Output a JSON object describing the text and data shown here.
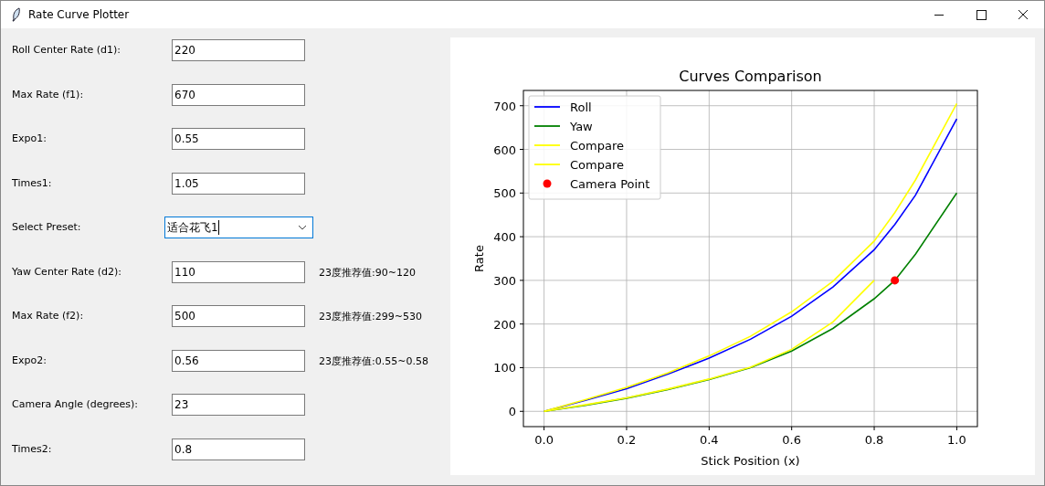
{
  "window": {
    "title": "Rate Curve Plotter"
  },
  "fields": [
    {
      "kind": "entry",
      "label": "Roll Center Rate (d1):",
      "value": "220"
    },
    {
      "kind": "entry",
      "label": "Max Rate (f1):",
      "value": "670"
    },
    {
      "kind": "entry",
      "label": "Expo1:",
      "value": "0.55"
    },
    {
      "kind": "entry",
      "label": "Times1:",
      "value": "1.05"
    },
    {
      "kind": "combobox",
      "label": "Select Preset:",
      "value": "适合花飞1",
      "focused": true
    },
    {
      "kind": "entry",
      "label": "Yaw Center Rate (d2):",
      "value": "110",
      "hint": "23度推荐值:90~120"
    },
    {
      "kind": "entry",
      "label": "Max Rate (f2):",
      "value": "500",
      "hint": "23度推荐值:299~530"
    },
    {
      "kind": "entry",
      "label": "Expo2:",
      "value": "0.56",
      "hint": "23度推荐值:0.55~0.58"
    },
    {
      "kind": "entry",
      "label": "Camera Angle (degrees):",
      "value": "23"
    },
    {
      "kind": "entry",
      "label": "Times2:",
      "value": "0.8"
    }
  ],
  "plot": {
    "chart_data": {
      "type": "line",
      "title": "Curves Comparison",
      "xlabel": "Stick Position (x)",
      "ylabel": "Rate",
      "x": [
        0,
        0.1,
        0.2,
        0.3,
        0.4,
        0.5,
        0.6,
        0.7,
        0.8,
        0.85,
        0.9,
        1.0
      ],
      "series": [
        {
          "name": "Roll",
          "color": "#0000ff",
          "values": [
            0,
            25,
            52,
            85,
            122,
            165,
            218,
            285,
            370,
            428,
            495,
            670
          ]
        },
        {
          "name": "Yaw",
          "color": "#008000",
          "values": [
            0,
            14,
            30,
            50,
            73,
            100,
            138,
            190,
            258,
            300,
            360,
            500
          ]
        },
        {
          "name": "Compare",
          "color": "#ffff00",
          "values": [
            0,
            27,
            55,
            88,
            127,
            172,
            228,
            298,
            390,
            455,
            530,
            705
          ]
        },
        {
          "name": "Compare",
          "color": "#ffff00",
          "values": [
            0,
            15,
            31,
            51,
            74,
            101,
            142,
            205,
            300,
            null,
            null,
            null
          ]
        },
        {
          "name": "Camera Point",
          "marker": "o",
          "color": "#ff0000",
          "values": [
            null,
            null,
            null,
            null,
            null,
            null,
            null,
            null,
            null,
            300,
            null,
            null
          ]
        }
      ],
      "grid": true,
      "legend": true,
      "xlim": [
        -0.05,
        1.05
      ],
      "ylim": [
        -35,
        735
      ],
      "xticks": [
        {
          "value": 0,
          "label": "0.0"
        },
        {
          "value": 0.2,
          "label": "0.2"
        },
        {
          "value": 0.4,
          "label": "0.4"
        },
        {
          "value": 0.6,
          "label": "0.6"
        },
        {
          "value": 0.8,
          "label": "0.8"
        },
        {
          "value": 1,
          "label": "1.0"
        }
      ],
      "yticks": [
        0,
        100,
        200,
        300,
        400,
        500,
        600,
        700
      ]
    }
  }
}
